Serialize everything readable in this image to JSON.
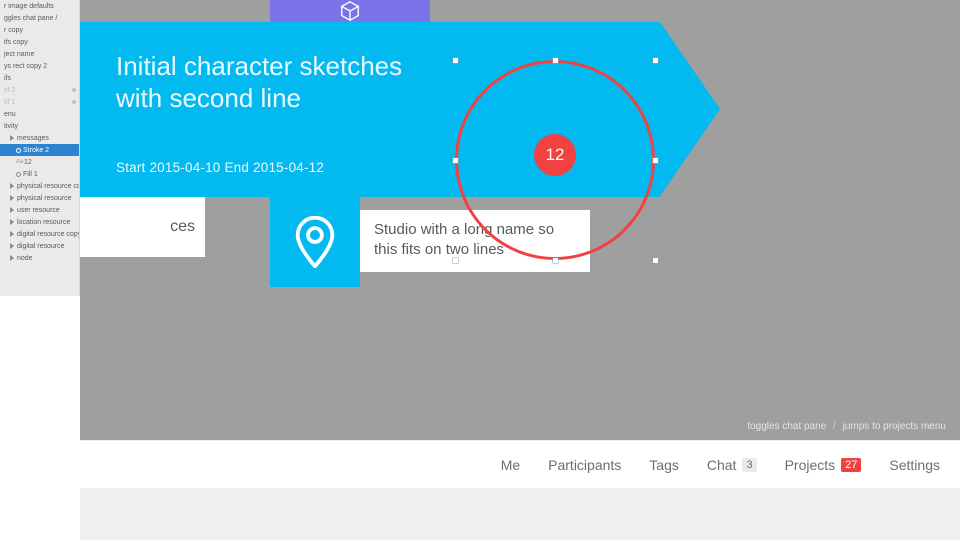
{
  "layers": {
    "items": [
      {
        "label": "r image defaults",
        "cls": "row"
      },
      {
        "label": "ggles chat pane  /",
        "cls": "row"
      },
      {
        "label": "r copy",
        "cls": "row"
      },
      {
        "label": "ifs copy",
        "cls": "row"
      },
      {
        "label": "ject name",
        "cls": "row"
      },
      {
        "label": "ys rect copy 2",
        "cls": "row"
      },
      {
        "label": "ifs",
        "cls": "row"
      },
      {
        "label": "tif 2",
        "cls": "row faded",
        "eye": true
      },
      {
        "label": "tif 1",
        "cls": "row faded",
        "eye": true
      },
      {
        "label": "enu",
        "cls": "row"
      },
      {
        "label": "tivity",
        "cls": "row"
      },
      {
        "label": "messages",
        "cls": "row group indent1"
      },
      {
        "label": "Stroke 2",
        "cls": "row indent2 selected",
        "glyph": "circle-sel"
      },
      {
        "label": "12",
        "cls": "row indent2",
        "glyph": "aa"
      },
      {
        "label": "Fill 1",
        "cls": "row indent2",
        "glyph": "circle"
      },
      {
        "label": "physical resource copy",
        "cls": "row group indent1"
      },
      {
        "label": "physical resource",
        "cls": "row group indent1"
      },
      {
        "label": "user resource",
        "cls": "row group indent1"
      },
      {
        "label": "location resource",
        "cls": "row group indent1"
      },
      {
        "label": "digital resource copy",
        "cls": "row group indent1"
      },
      {
        "label": "digital resource",
        "cls": "row group indent1"
      },
      {
        "label": "node",
        "cls": "row group indent1"
      }
    ]
  },
  "card": {
    "title_line1": "Initial character sketches",
    "title_line2": "with second line",
    "dates": "Start 2015-04-10 End 2015-04-12",
    "badge": "12",
    "studio": "Studio with a long name so this fits on two lines",
    "resources_fragment": "ces"
  },
  "helper": {
    "left": "toggles chat pane",
    "right": "jumps to projects menu"
  },
  "toolbar": {
    "me": "Me",
    "participants": "Participants",
    "tags": "Tags",
    "chat": "Chat",
    "chat_count": "3",
    "projects": "Projects",
    "projects_count": "27",
    "settings": "Settings"
  },
  "colors": {
    "blue": "#03baf0",
    "red": "#f24141",
    "purple": "#7a74e8",
    "canvas": "#9f9f9f"
  }
}
